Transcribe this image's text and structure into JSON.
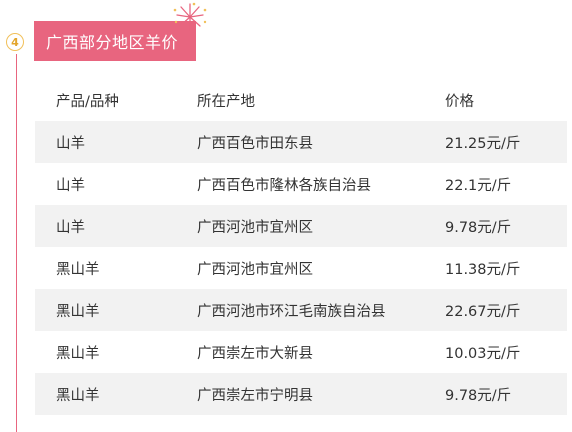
{
  "section": {
    "step_number": "4",
    "title": "广西部分地区羊价",
    "accent_color": "#e8657f",
    "badge_color": "#f1c05a"
  },
  "table": {
    "headers": [
      "产品/品种",
      "所在产地",
      "价格"
    ],
    "rows": [
      {
        "product": "山羊",
        "origin": "广西百色市田东县",
        "price": "21.25元/斤"
      },
      {
        "product": "山羊",
        "origin": "广西百色市隆林各族自治县",
        "price": "22.1元/斤"
      },
      {
        "product": "山羊",
        "origin": "广西河池市宜州区",
        "price": "9.78元/斤"
      },
      {
        "product": "黑山羊",
        "origin": "广西河池市宜州区",
        "price": "11.38元/斤"
      },
      {
        "product": "黑山羊",
        "origin": "广西河池市环江毛南族自治县",
        "price": "22.67元/斤"
      },
      {
        "product": "黑山羊",
        "origin": "广西崇左市大新县",
        "price": "10.03元/斤"
      },
      {
        "product": "黑山羊",
        "origin": "广西崇左市宁明县",
        "price": "9.78元/斤"
      }
    ]
  },
  "icons": {
    "decoration": "firework-icon"
  }
}
